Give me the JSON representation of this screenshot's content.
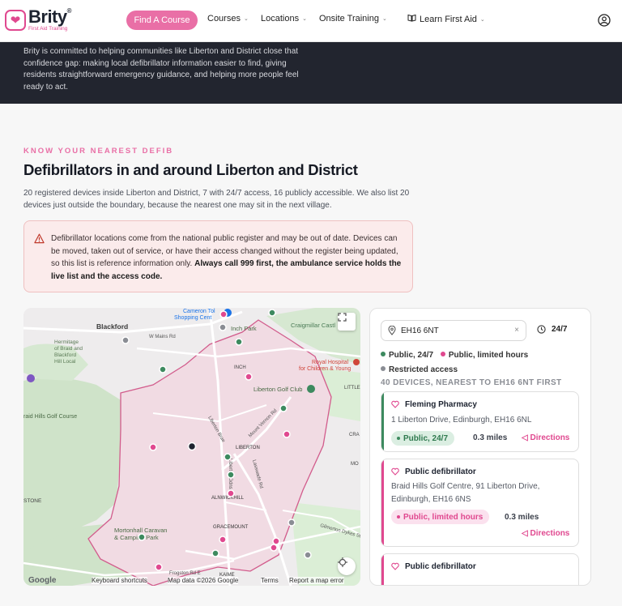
{
  "header": {
    "logo_name": "Brity",
    "logo_reg": "®",
    "logo_sub": "First Aid Training",
    "find_course": "Find A Course",
    "nav": [
      {
        "label": "Courses"
      },
      {
        "label": "Locations"
      },
      {
        "label": "Onsite Training"
      },
      {
        "label": "Learn First Aid"
      }
    ]
  },
  "hero": {
    "text": "Brity is committed to helping communities like Liberton and District close that confidence gap: making local defibrillator information easier to find, giving residents straightforward emergency guidance, and helping more people feel ready to act."
  },
  "section": {
    "eyebrow": "KNOW YOUR NEAREST DEFIB",
    "title": "Defibrillators in and around Liberton and District",
    "intro": "20 registered devices inside Liberton and District, 7 with 24/7 access, 16 publicly accessible. We also list 20 devices just outside the boundary, because the nearest one may sit in the next village.",
    "warning_text": "Defibrillator locations come from the national public register and may be out of date. Devices can be moved, taken out of service, or have their access changed without the register being updated, so this list is reference information only.",
    "warning_bold": "Always call 999 first, the ambulance service holds the live list and the access code."
  },
  "map": {
    "labels": {
      "blackford": "Blackford",
      "hermitage": [
        "Hermitage",
        "of Braid and",
        "Blackford",
        "Hill Local"
      ],
      "braid_hills": "raid Hills Golf Course",
      "inch_park": "Inch Park",
      "inch": "INCH",
      "craigmillar": "Craigmillar Castl",
      "royal_hospital": [
        "Royal Hospital",
        "for Children & Young"
      ],
      "liberton_golf": "Liberton Golf Club",
      "liberton": "LIBERTON",
      "alnwickhill": "ALNWICKHILL",
      "gracemount": "GRACEMOUNT",
      "stone": "STONE",
      "mortonhall": [
        "Mortonhall Caravan",
        "& Camping Park"
      ],
      "cameron_toll": [
        "Cameron Tol",
        "Shopping Cent"
      ],
      "kaimes": "KAIME",
      "little": "LITTLE",
      "cra": "CRA",
      "mo": "MO",
      "w_mains": "W Mains Rd",
      "liberton_brae": "Liberton Brae",
      "mount_vernon": "Mount Vernon Rd",
      "lasswade": "Lasswade Rd",
      "liberton_gdns": "Liberton Gdns",
      "gilmerton": "Gilmerton Dykes St",
      "frogston": "Frogston Rd E"
    },
    "footer": {
      "google": "Google",
      "shortcuts": "Keyboard shortcuts",
      "mapdata": "Map data ©2026 Google",
      "terms": "Terms",
      "report": "Report a map error"
    }
  },
  "panel": {
    "search_value": "EH16 6NT",
    "clear": "×",
    "toggle_label": "24/7",
    "legend": [
      {
        "label": "Public, 24/7",
        "color": "#3d8a5f"
      },
      {
        "label": "Public, limited hours",
        "color": "#e0488f"
      },
      {
        "label": "Restricted access",
        "color": "#8a8d94"
      }
    ],
    "count": "40 DEVICES, NEAREST TO EH16 6NT FIRST",
    "cards": [
      {
        "name": "Fleming Pharmacy",
        "address": "1 Liberton Drive, Edinburgh, EH16 6NL",
        "badge": "Public, 24/7",
        "miles": "0.3 miles",
        "directions": "Directions"
      },
      {
        "name": "Public defibrillator",
        "address": "Braid Hills Golf Centre, 91 Liberton Drive, Edinburgh, EH16 6NS",
        "badge": "Public, limited hours",
        "miles": "0.3 miles",
        "directions": "Directions"
      },
      {
        "name": "Public defibrillator"
      }
    ]
  },
  "colors": {
    "brand_pink": "#e0488f",
    "green": "#3d8a5f",
    "grey": "#8a8d94",
    "dark_band": "#22252f"
  }
}
